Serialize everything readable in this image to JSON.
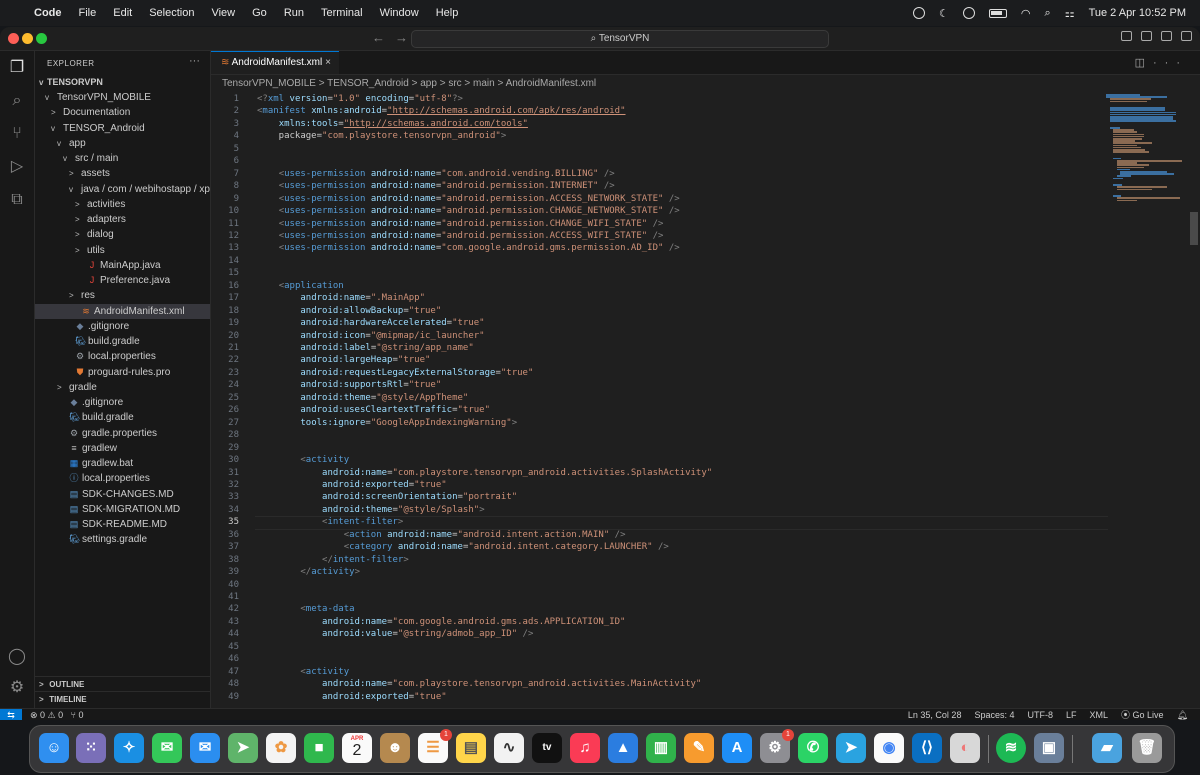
{
  "menubar": {
    "items": [
      "Code",
      "File",
      "Edit",
      "Selection",
      "View",
      "Go",
      "Run",
      "Terminal",
      "Window",
      "Help"
    ],
    "clock": "Tue 2 Apr  10:52 PM"
  },
  "titlebar": {
    "search": "TensorVPN"
  },
  "explorer": {
    "title": "EXPLORER",
    "root": "TENSORVPN",
    "tree": [
      {
        "label": "TensorVPN_MOBILE",
        "depth": 1,
        "chev": "v",
        "icon": ""
      },
      {
        "label": "Documentation",
        "depth": 2,
        "chev": ">",
        "icon": ""
      },
      {
        "label": "TENSOR_Android",
        "depth": 2,
        "chev": "v",
        "icon": ""
      },
      {
        "label": "app",
        "depth": 3,
        "chev": "v",
        "icon": ""
      },
      {
        "label": "src / main",
        "depth": 4,
        "chev": "v",
        "icon": ""
      },
      {
        "label": "assets",
        "depth": 5,
        "chev": ">",
        "icon": ""
      },
      {
        "label": "java / com / webihostapp / xpro...",
        "depth": 5,
        "chev": "v",
        "icon": ""
      },
      {
        "label": "activities",
        "depth": 6,
        "chev": ">",
        "icon": ""
      },
      {
        "label": "adapters",
        "depth": 6,
        "chev": ">",
        "icon": ""
      },
      {
        "label": "dialog",
        "depth": 6,
        "chev": ">",
        "icon": ""
      },
      {
        "label": "utils",
        "depth": 6,
        "chev": ">",
        "icon": ""
      },
      {
        "label": "MainApp.java",
        "depth": 6,
        "chev": "",
        "icon": "J"
      },
      {
        "label": "Preference.java",
        "depth": 6,
        "chev": "",
        "icon": "J"
      },
      {
        "label": "res",
        "depth": 5,
        "chev": ">",
        "icon": ""
      },
      {
        "label": "AndroidManifest.xml",
        "depth": 5,
        "chev": "",
        "icon": "xml",
        "selected": true
      },
      {
        "label": ".gitignore",
        "depth": 4,
        "chev": "",
        "icon": "git"
      },
      {
        "label": "build.gradle",
        "depth": 4,
        "chev": "",
        "icon": "gradle"
      },
      {
        "label": "local.properties",
        "depth": 4,
        "chev": "",
        "icon": "gear"
      },
      {
        "label": "proguard-rules.pro",
        "depth": 4,
        "chev": "",
        "icon": "shield"
      },
      {
        "label": "gradle",
        "depth": 3,
        "chev": ">",
        "icon": ""
      },
      {
        "label": ".gitignore",
        "depth": 3,
        "chev": "",
        "icon": "git"
      },
      {
        "label": "build.gradle",
        "depth": 3,
        "chev": "",
        "icon": "gradle"
      },
      {
        "label": "gradle.properties",
        "depth": 3,
        "chev": "",
        "icon": "gear"
      },
      {
        "label": "gradlew",
        "depth": 3,
        "chev": "",
        "icon": "list"
      },
      {
        "label": "gradlew.bat",
        "depth": 3,
        "chev": "",
        "icon": "win"
      },
      {
        "label": "local.properties",
        "depth": 3,
        "chev": "",
        "icon": "info"
      },
      {
        "label": "SDK-CHANGES.MD",
        "depth": 3,
        "chev": "",
        "icon": "md"
      },
      {
        "label": "SDK-MIGRATION.MD",
        "depth": 3,
        "chev": "",
        "icon": "md"
      },
      {
        "label": "SDK-README.MD",
        "depth": 3,
        "chev": "",
        "icon": "md"
      },
      {
        "label": "settings.gradle",
        "depth": 3,
        "chev": "",
        "icon": "gradle"
      }
    ],
    "outline": "OUTLINE",
    "timeline": "TIMELINE"
  },
  "editor": {
    "tab": "AndroidManifest.xml",
    "breadcrumb": "TensorVPN_MOBILE  >  TENSOR_Android  >  app  >  src  >  main  >  AndroidManifest.xml",
    "current_line": 35,
    "lines": [
      "<?xml version=\"1.0\" encoding=\"utf-8\"?>",
      "<manifest xmlns:android=\"http://schemas.android.com/apk/res/android\"",
      "    xmlns:tools=\"http://schemas.android.com/tools\"",
      "    package=\"com.playstore.tensorvpn_android\">",
      "",
      "",
      "    <uses-permission android:name=\"com.android.vending.BILLING\" />",
      "    <uses-permission android:name=\"android.permission.INTERNET\" />",
      "    <uses-permission android:name=\"android.permission.ACCESS_NETWORK_STATE\" />",
      "    <uses-permission android:name=\"android.permission.CHANGE_NETWORK_STATE\" />",
      "    <uses-permission android:name=\"android.permission.CHANGE_WIFI_STATE\" />",
      "    <uses-permission android:name=\"android.permission.ACCESS_WIFI_STATE\" />",
      "    <uses-permission android:name=\"com.google.android.gms.permission.AD_ID\" />",
      "",
      "",
      "    <application",
      "        android:name=\".MainApp\"",
      "        android:allowBackup=\"true\"",
      "        android:hardwareAccelerated=\"true\"",
      "        android:icon=\"@mipmap/ic_launcher\"",
      "        android:label=\"@string/app_name\"",
      "        android:largeHeap=\"true\"",
      "        android:requestLegacyExternalStorage=\"true\"",
      "        android:supportsRtl=\"true\"",
      "        android:theme=\"@style/AppTheme\"",
      "        android:usesCleartextTraffic=\"true\"",
      "        tools:ignore=\"GoogleAppIndexingWarning\">",
      "",
      "",
      "        <activity",
      "            android:name=\"com.playstore.tensorvpn_android.activities.SplashActivity\"",
      "            android:exported=\"true\"",
      "            android:screenOrientation=\"portrait\"",
      "            android:theme=\"@style/Splash\">",
      "            <intent-filter>",
      "                <action android:name=\"android.intent.action.MAIN\" />",
      "                <category android:name=\"android.intent.category.LAUNCHER\" />",
      "            </intent-filter>",
      "        </activity>",
      "",
      "",
      "        <meta-data",
      "            android:name=\"com.google.android.gms.ads.APPLICATION_ID\"",
      "            android:value=\"@string/admob_app_ID\" />",
      "",
      "",
      "        <activity",
      "            android:name=\"com.playstore.tensorvpn_android.activities.MainActivity\"",
      "            android:exported=\"true\""
    ]
  },
  "statusbar": {
    "problems": "⊗ 0 ⚠ 0",
    "ports": "⑂ 0",
    "position": "Ln 35, Col 28",
    "spaces": "Spaces: 4",
    "encoding": "UTF-8",
    "eol": "LF",
    "language": "XML",
    "golive": "Go Live"
  },
  "dock": {
    "calendar_month": "APR",
    "calendar_day": "2",
    "badges": {
      "reminders": "1",
      "settings": "1"
    }
  },
  "colors": {
    "accent": "#0078d4",
    "tag": "#569cd6",
    "attr": "#9cdcfe",
    "string": "#ce9178"
  }
}
